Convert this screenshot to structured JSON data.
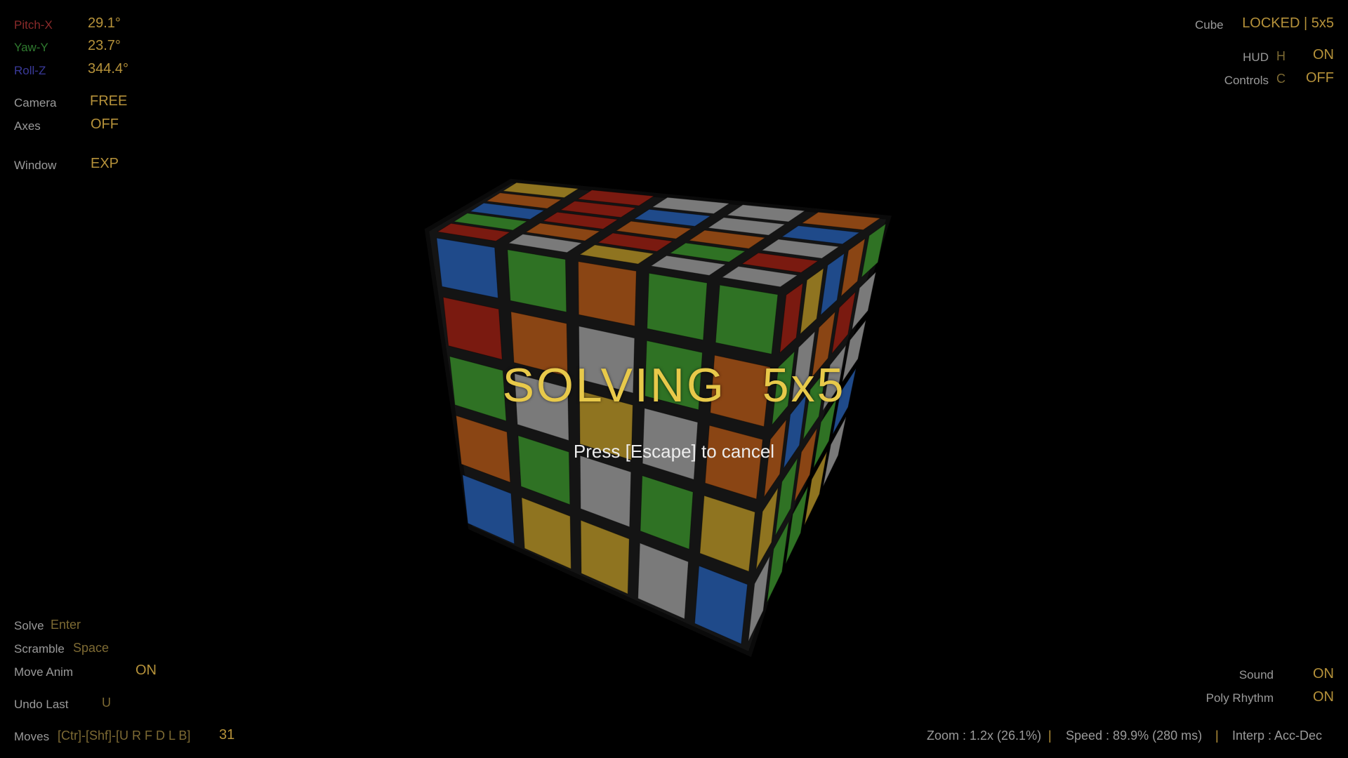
{
  "orientation": {
    "pitch_label": "Pitch-X",
    "pitch_value": "29.1°",
    "yaw_label": "Yaw-Y",
    "yaw_value": "23.7°",
    "roll_label": "Roll-Z",
    "roll_value": "344.4°"
  },
  "view": {
    "camera_label": "Camera",
    "camera_value": "FREE",
    "axes_label": "Axes",
    "axes_value": "OFF",
    "window_label": "Window",
    "window_value": "EXP"
  },
  "top_right": {
    "cube_label": "Cube",
    "cube_value": "LOCKED | 5x5",
    "hud_label": "HUD",
    "hud_key": "H",
    "hud_value": "ON",
    "controls_label": "Controls",
    "controls_key": "C",
    "controls_value": "OFF"
  },
  "bottom_left": {
    "solve_label": "Solve",
    "solve_key": "Enter",
    "scramble_label": "Scramble",
    "scramble_key": "Space",
    "move_anim_label": "Move Anim",
    "move_anim_value": "ON",
    "undo_label": "Undo Last",
    "undo_key": "U",
    "moves_label": "Moves",
    "moves_keys": "[Ctr]-[Shf]-[U R F D L B]",
    "moves_count": "31"
  },
  "bottom_right": {
    "sound_label": "Sound",
    "sound_value": "ON",
    "poly_label": "Poly Rhythm",
    "poly_value": "ON"
  },
  "status_bar": {
    "zoom": "Zoom : 1.2x (26.1%)",
    "speed": "Speed : 89.9% (280 ms)",
    "interp": "Interp : Acc-Dec",
    "separator": "|"
  },
  "overlay": {
    "title": "SOLVING  5x5",
    "subtitle": "Press [Escape] to cancel"
  },
  "cube": {
    "size": 5,
    "colors": {
      "W": "#7a7a7a",
      "Y": "#8f7420",
      "R": "#7a1a10",
      "O": "#8a4514",
      "G": "#2f7224",
      "B": "#1f4a8a"
    },
    "front": [
      [
        "B",
        "G",
        "O",
        "G",
        "G"
      ],
      [
        "R",
        "O",
        "W",
        "G",
        "O"
      ],
      [
        "G",
        "W",
        "Y",
        "W",
        "O"
      ],
      [
        "O",
        "G",
        "W",
        "G",
        "Y"
      ],
      [
        "B",
        "Y",
        "Y",
        "W",
        "B"
      ]
    ],
    "front_bottom": [
      "B",
      "Y",
      "Y",
      "B",
      "B"
    ],
    "top": [
      [
        "Y",
        "R",
        "W",
        "W",
        "O"
      ],
      [
        "O",
        "R",
        "B",
        "W",
        "B"
      ],
      [
        "B",
        "R",
        "O",
        "O",
        "W"
      ],
      [
        "G",
        "O",
        "R",
        "G",
        "R"
      ],
      [
        "R",
        "W",
        "Y",
        "W",
        "W"
      ]
    ],
    "right": [
      [
        "R",
        "Y",
        "B",
        "O",
        "G"
      ],
      [
        "G",
        "W",
        "O",
        "R",
        "W"
      ],
      [
        "O",
        "B",
        "G",
        "W",
        "W"
      ],
      [
        "Y",
        "G",
        "O",
        "G",
        "B"
      ],
      [
        "W",
        "G",
        "G",
        "Y",
        "W"
      ]
    ]
  }
}
